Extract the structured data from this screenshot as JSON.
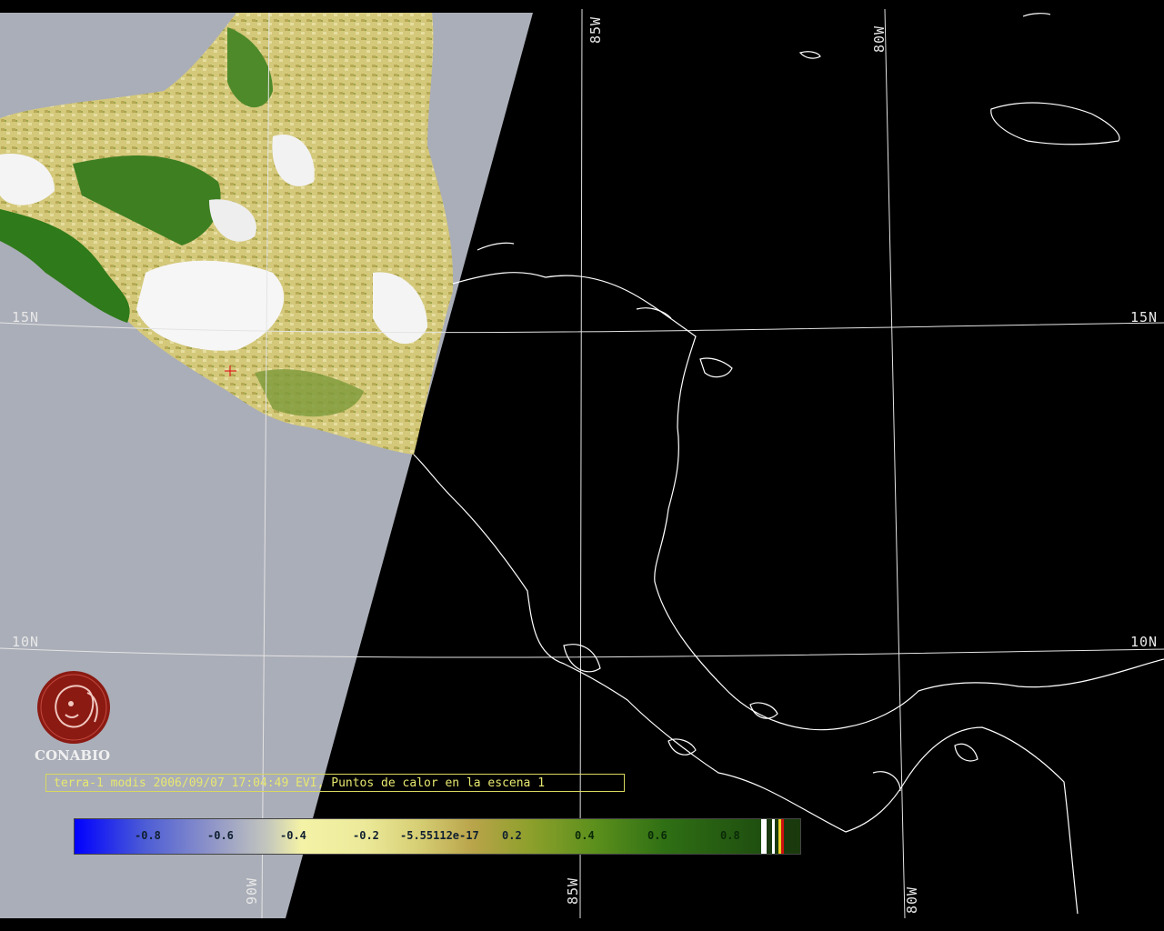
{
  "map": {
    "grid_labels": {
      "lat_15_left": "15N",
      "lat_15_right": "15N",
      "lat_10_left": "10N",
      "lat_10_right": "10N",
      "lon_85_top": "85W",
      "lon_80_top": "80W",
      "lon_90_bottom": "90W",
      "lon_85_bottom": "85W",
      "lon_80_bottom": "80W"
    }
  },
  "logo": {
    "name": "CONABIO",
    "icon": "conabio-logo-icon",
    "color": "#8b1a12"
  },
  "caption": "terra-1 modis 2006/09/07 17:04:49 EVI, Puntos de calor en la escena 1",
  "colorbar": {
    "labels": [
      "-0.8",
      "-0.6",
      "-0.4",
      "-0.2",
      "-5.55112e-17",
      "0.2",
      "0.4",
      "0.6",
      "0.8"
    ],
    "colors": {
      "low": "#0000ff",
      "mid": "#f4f2a6",
      "high": "#1f4f10",
      "hotspot_red": "#cc1010",
      "hotspot_yellow": "#e8d020"
    }
  },
  "colors": {
    "no_data": "#aaaeb8",
    "coastline": "#ffffff",
    "background": "#000000",
    "cloud": "#ffffff"
  }
}
